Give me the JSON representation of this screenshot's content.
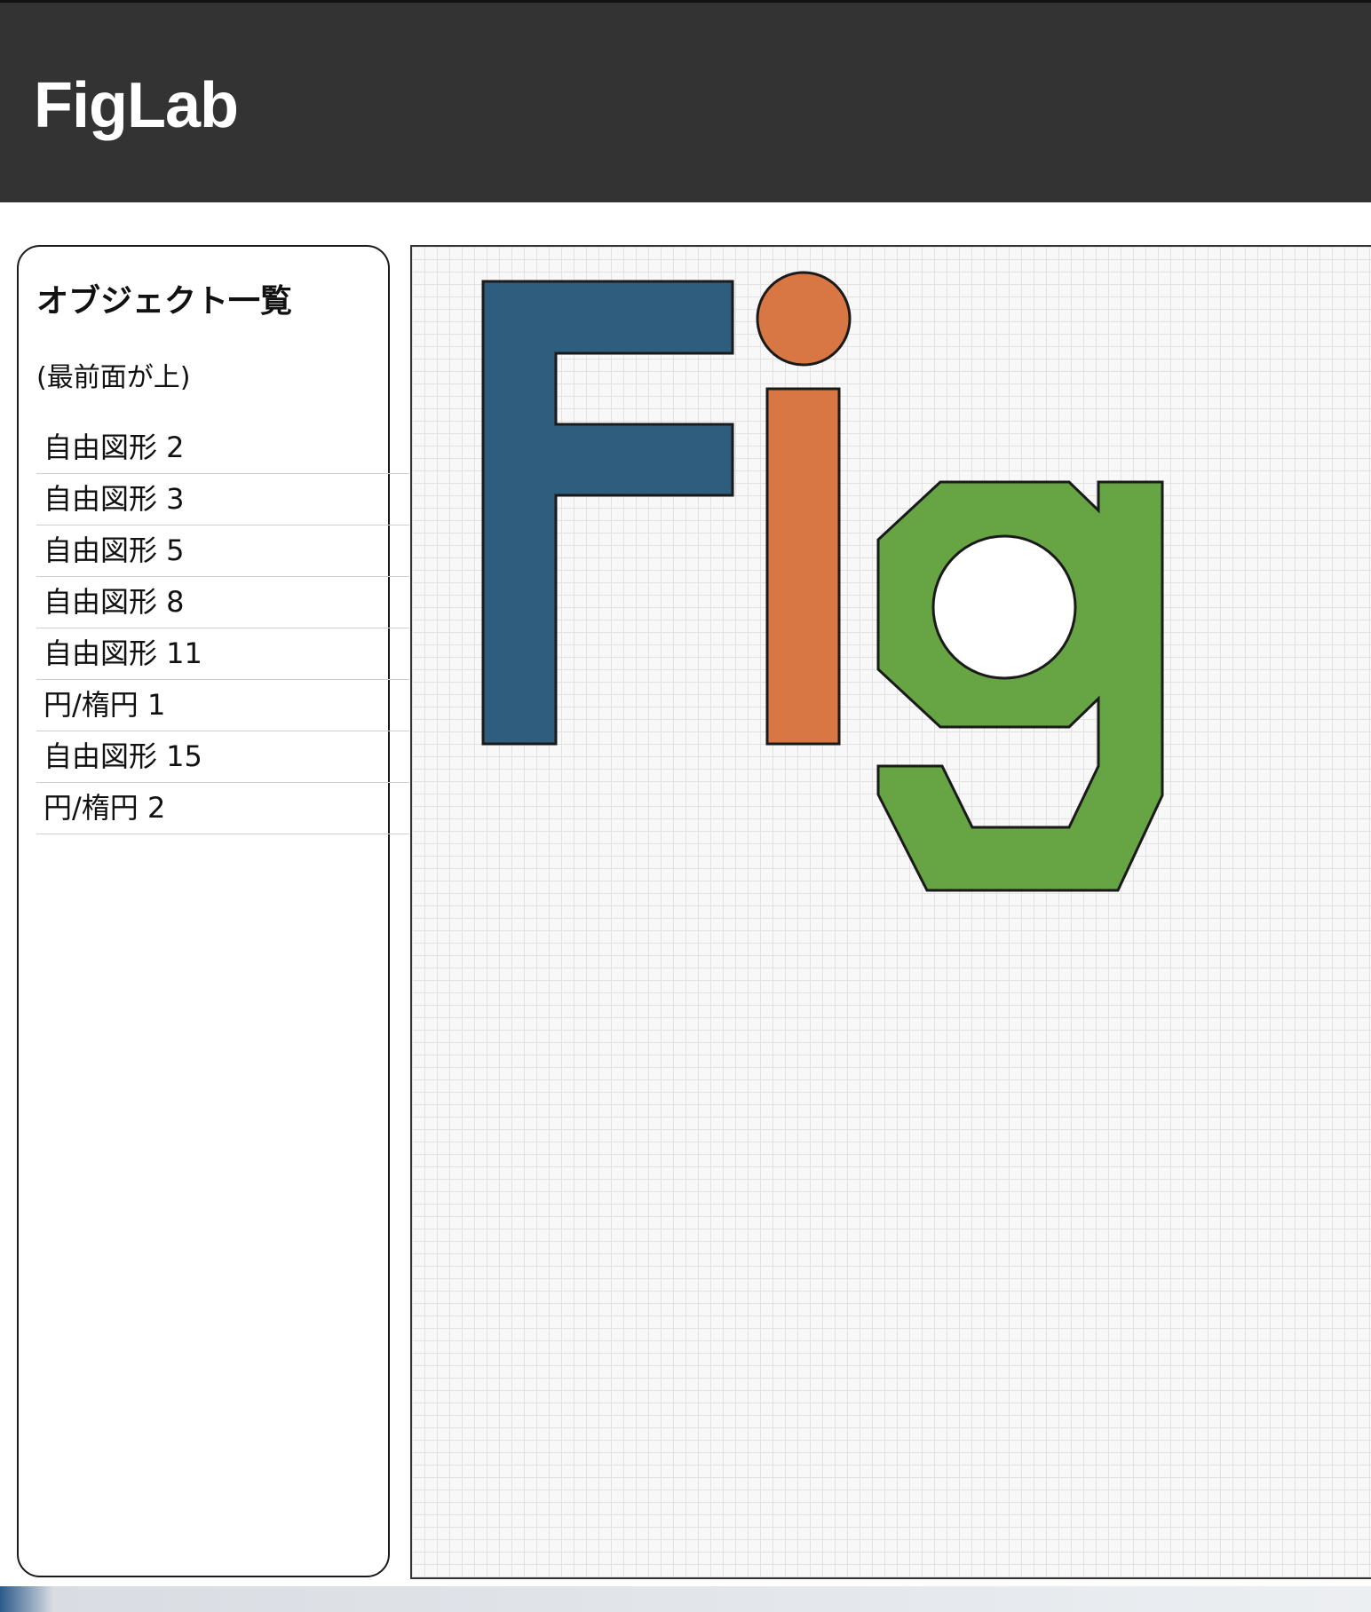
{
  "app": {
    "title": "FigLab"
  },
  "sidebar": {
    "title": "オブジェクト一覧",
    "subtitle": "(最前面が上)",
    "items": [
      {
        "label": "自由図形 2"
      },
      {
        "label": "自由図形 3"
      },
      {
        "label": "自由図形 5"
      },
      {
        "label": "自由図形 8"
      },
      {
        "label": "自由図形 11"
      },
      {
        "label": "円/楕円 1"
      },
      {
        "label": "自由図形 15"
      },
      {
        "label": "円/楕円 2"
      }
    ]
  },
  "canvas": {
    "shapes": [
      {
        "name": "letter-f-shape",
        "kind": "freeform",
        "fill": "#2e5d7e"
      },
      {
        "name": "letter-i-stem-shape",
        "kind": "freeform",
        "fill": "#d87743"
      },
      {
        "name": "letter-i-dot-shape",
        "kind": "ellipse",
        "fill": "#d87743"
      },
      {
        "name": "letter-g-upper-shape",
        "kind": "freeform",
        "fill": "#67a443"
      },
      {
        "name": "letter-g-tail-shape",
        "kind": "freeform",
        "fill": "#67a443"
      },
      {
        "name": "letter-g-hole-shape",
        "kind": "ellipse",
        "fill": "#ffffff"
      }
    ],
    "stroke": "#1a1a1a",
    "grid_color": "#e2e2e2",
    "background": "#f8f8f8"
  }
}
